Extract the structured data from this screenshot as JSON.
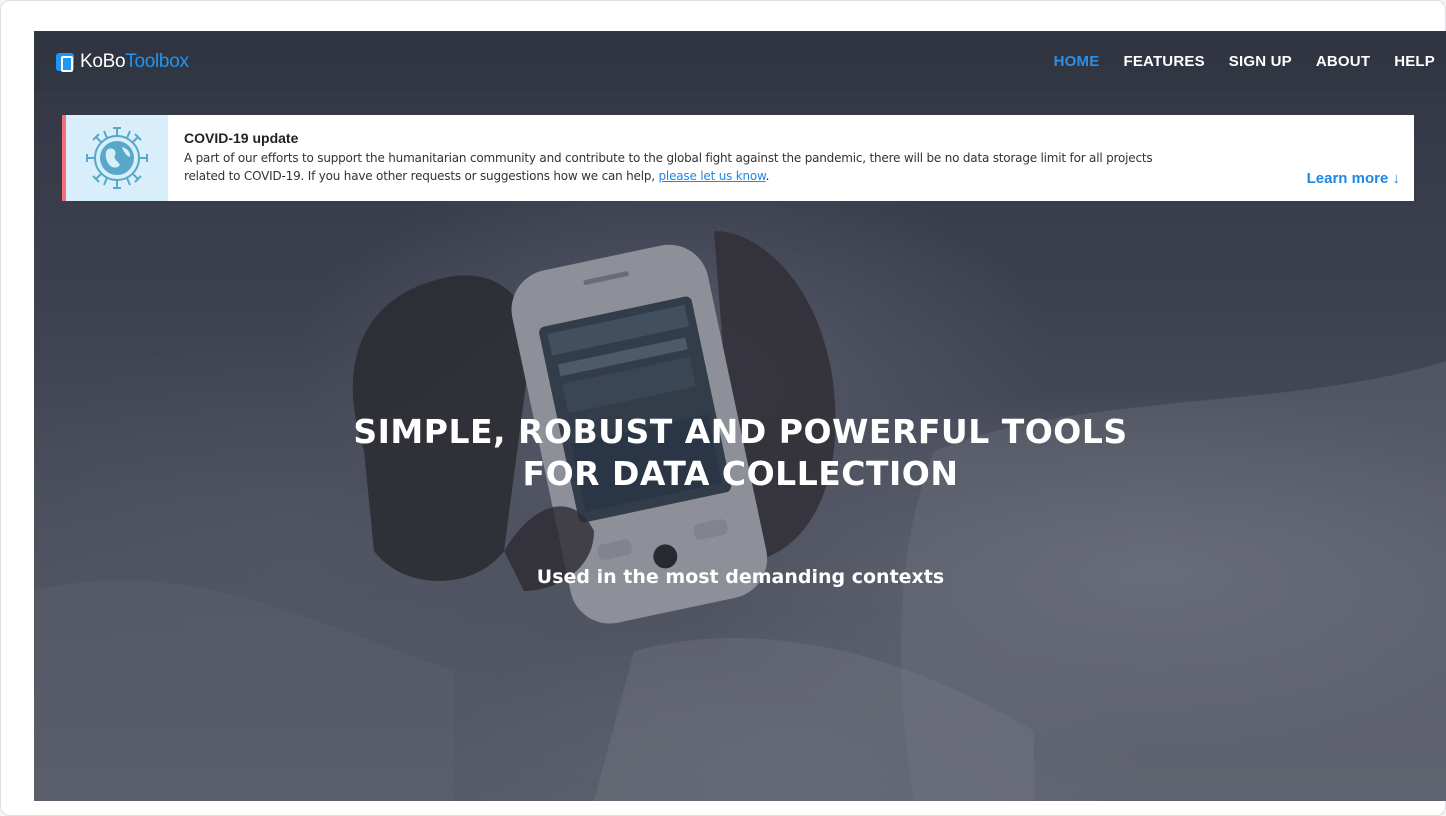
{
  "brand": {
    "kobo": "KoBo",
    "toolbox": "Toolbox",
    "accent": "#2095f3"
  },
  "nav": {
    "items": [
      {
        "label": "HOME",
        "active": true
      },
      {
        "label": "FEATURES",
        "active": false
      },
      {
        "label": "SIGN UP",
        "active": false
      },
      {
        "label": "ABOUT",
        "active": false
      },
      {
        "label": "HELP",
        "active": false
      }
    ]
  },
  "banner": {
    "icon": "globe-virus-icon",
    "title": "COVID-19 update",
    "body_line1": "A part of our efforts to support the humanitarian community and contribute to the global fight against the pandemic, there will be no data storage limit for all projects",
    "body_line2": "related to COVID-19. If you have other requests or suggestions how we can help, ",
    "link": "please let us know",
    "body_end": ".",
    "learn_more": "Learn more ↓",
    "accent_border": "#f2707b"
  },
  "hero": {
    "headline_line1": "SIMPLE, ROBUST AND POWERFUL TOOLS",
    "headline_line2": "FOR DATA COLLECTION",
    "subline": "Used in the most demanding contexts"
  }
}
